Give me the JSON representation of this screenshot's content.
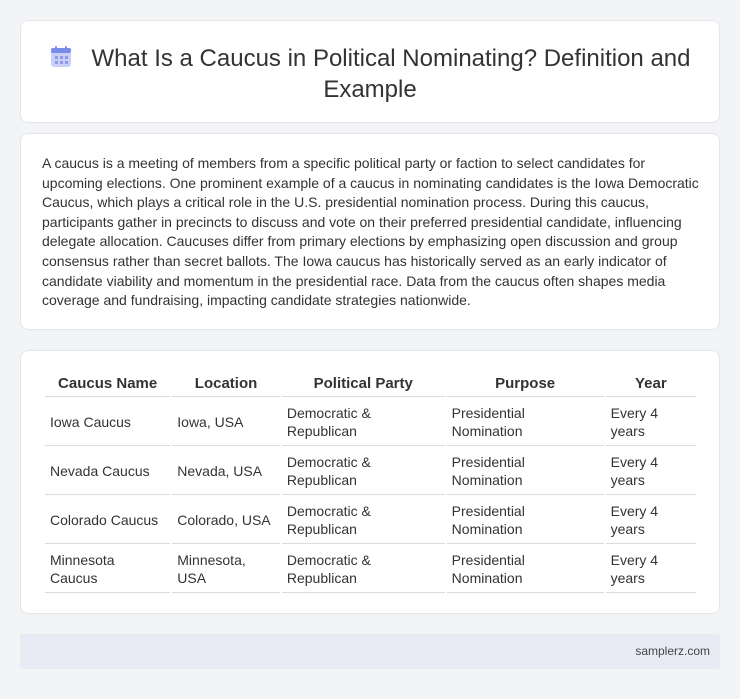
{
  "header": {
    "title": "What Is a Caucus in Political Nominating? Definition and Example",
    "icon": "calendar-icon",
    "icon_color": "#7b8ce8"
  },
  "article": {
    "text": "A caucus is a meeting of members from a specific political party or faction to select candidates for upcoming elections. One prominent example of a caucus in nominating candidates is the Iowa Democratic Caucus, which plays a critical role in the U.S. presidential nomination process. During this caucus, participants gather in precincts to discuss and vote on their preferred presidential candidate, influencing delegate allocation. Caucuses differ from primary elections by emphasizing open discussion and group consensus rather than secret ballots. The Iowa caucus has historically served as an early indicator of candidate viability and momentum in the presidential race. Data from the caucus often shapes media coverage and fundraising, impacting candidate strategies nationwide."
  },
  "table": {
    "headers": [
      "Caucus Name",
      "Location",
      "Political Party",
      "Purpose",
      "Year"
    ],
    "rows": [
      [
        "Iowa Caucus",
        "Iowa, USA",
        "Democratic & Republican",
        "Presidential Nomination",
        "Every 4 years"
      ],
      [
        "Nevada Caucus",
        "Nevada, USA",
        "Democratic & Republican",
        "Presidential Nomination",
        "Every 4 years"
      ],
      [
        "Colorado Caucus",
        "Colorado, USA",
        "Democratic & Republican",
        "Presidential Nomination",
        "Every 4 years"
      ],
      [
        "Minnesota Caucus",
        "Minnesota, USA",
        "Democratic & Republican",
        "Presidential Nomination",
        "Every 4 years"
      ]
    ]
  },
  "footer": {
    "site": "samplerz.com"
  }
}
